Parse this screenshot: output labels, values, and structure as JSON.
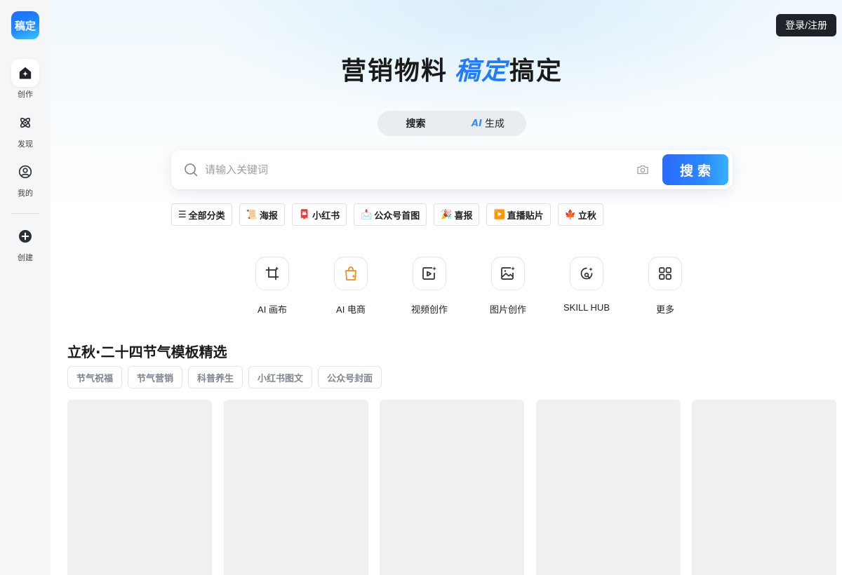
{
  "sidebar": {
    "logo_text": "稿定",
    "items": [
      {
        "label": "创作",
        "icon": "home-spark-icon",
        "active": true
      },
      {
        "label": "发现",
        "icon": "atom-icon",
        "active": false
      },
      {
        "label": "我的",
        "icon": "user-circle-icon",
        "active": false
      },
      {
        "label": "创建",
        "icon": "plus-circle-icon",
        "active": false
      }
    ]
  },
  "header": {
    "login_label": "登录/注册"
  },
  "hero": {
    "title_prefix": "营销物料",
    "brand": "稿定",
    "title_suffix": "搞定"
  },
  "mode_toggle": {
    "search_label": "搜索",
    "generate_label": "生成",
    "generate_mark": "AI",
    "selected": "搜索"
  },
  "search": {
    "placeholder": "请输入关键词",
    "value": "",
    "button_label": "搜索"
  },
  "chips": [
    {
      "label": "全部分类",
      "icon": "☰"
    },
    {
      "label": "海报",
      "icon": "📜"
    },
    {
      "label": "小红书",
      "icon": "📮"
    },
    {
      "label": "公众号首图",
      "icon": "📩"
    },
    {
      "label": "喜报",
      "icon": "🎉"
    },
    {
      "label": "直播贴片",
      "icon": "▶️"
    },
    {
      "label": "立秋",
      "icon": "🍁"
    }
  ],
  "tools": [
    {
      "label": "AI 画布",
      "icon": "crop-canvas-icon"
    },
    {
      "label": "AI 电商",
      "icon": "shopping-bag-icon"
    },
    {
      "label": "视频创作",
      "icon": "video-sparkle-icon"
    },
    {
      "label": "图片创作",
      "icon": "image-sparkle-icon"
    },
    {
      "label": "SKILL HUB",
      "icon": "skill-hub-icon"
    },
    {
      "label": "更多",
      "icon": "grid-icon"
    }
  ],
  "section": {
    "title": "立秋·二十四节气模板精选",
    "tags": [
      "节气祝福",
      "节气营销",
      "科普养生",
      "小红书图文",
      "公众号封面"
    ]
  },
  "colors": {
    "accent": "#1f7cff",
    "search_button_start": "#2a6bff",
    "search_button_end": "#38b1ff",
    "login_bg": "#1f2329",
    "card_placeholder": "#eff0f2"
  }
}
